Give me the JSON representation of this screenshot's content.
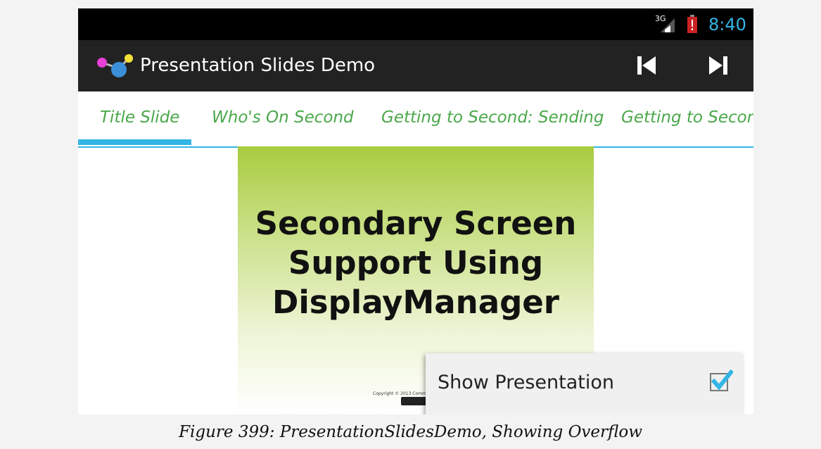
{
  "status_bar": {
    "network": "3G",
    "time": "8:40",
    "icons": [
      "signal-icon",
      "battery-alert-icon"
    ],
    "time_color": "#33b5e5"
  },
  "action_bar": {
    "app_icon": "molecule-app-icon",
    "title": "Presentation Slides Demo",
    "actions": [
      {
        "name": "previous",
        "icon": "skip-previous-icon"
      },
      {
        "name": "next",
        "icon": "skip-next-icon"
      }
    ]
  },
  "tabs": {
    "items": [
      {
        "label": "Title Slide",
        "selected": true
      },
      {
        "label": "Who's On Second",
        "selected": false
      },
      {
        "label": "Getting to Second: Sending",
        "selected": false
      },
      {
        "label": "Getting to Second:",
        "selected": false
      }
    ],
    "text_color": "#4aa84a",
    "indicator_color": "#33b5e5"
  },
  "slide": {
    "title_lines": [
      "Secondary Screen",
      "Support Using",
      "DisplayManager"
    ],
    "copyright": "Copyright © 2013 Comm",
    "gradient_top": "#a9cc3f"
  },
  "overflow_menu": {
    "items": [
      {
        "label": "Show Presentation",
        "checked": true,
        "icon": "checkbox-checked-icon"
      }
    ]
  },
  "caption": "Figure 399: PresentationSlidesDemo, Showing Overflow"
}
